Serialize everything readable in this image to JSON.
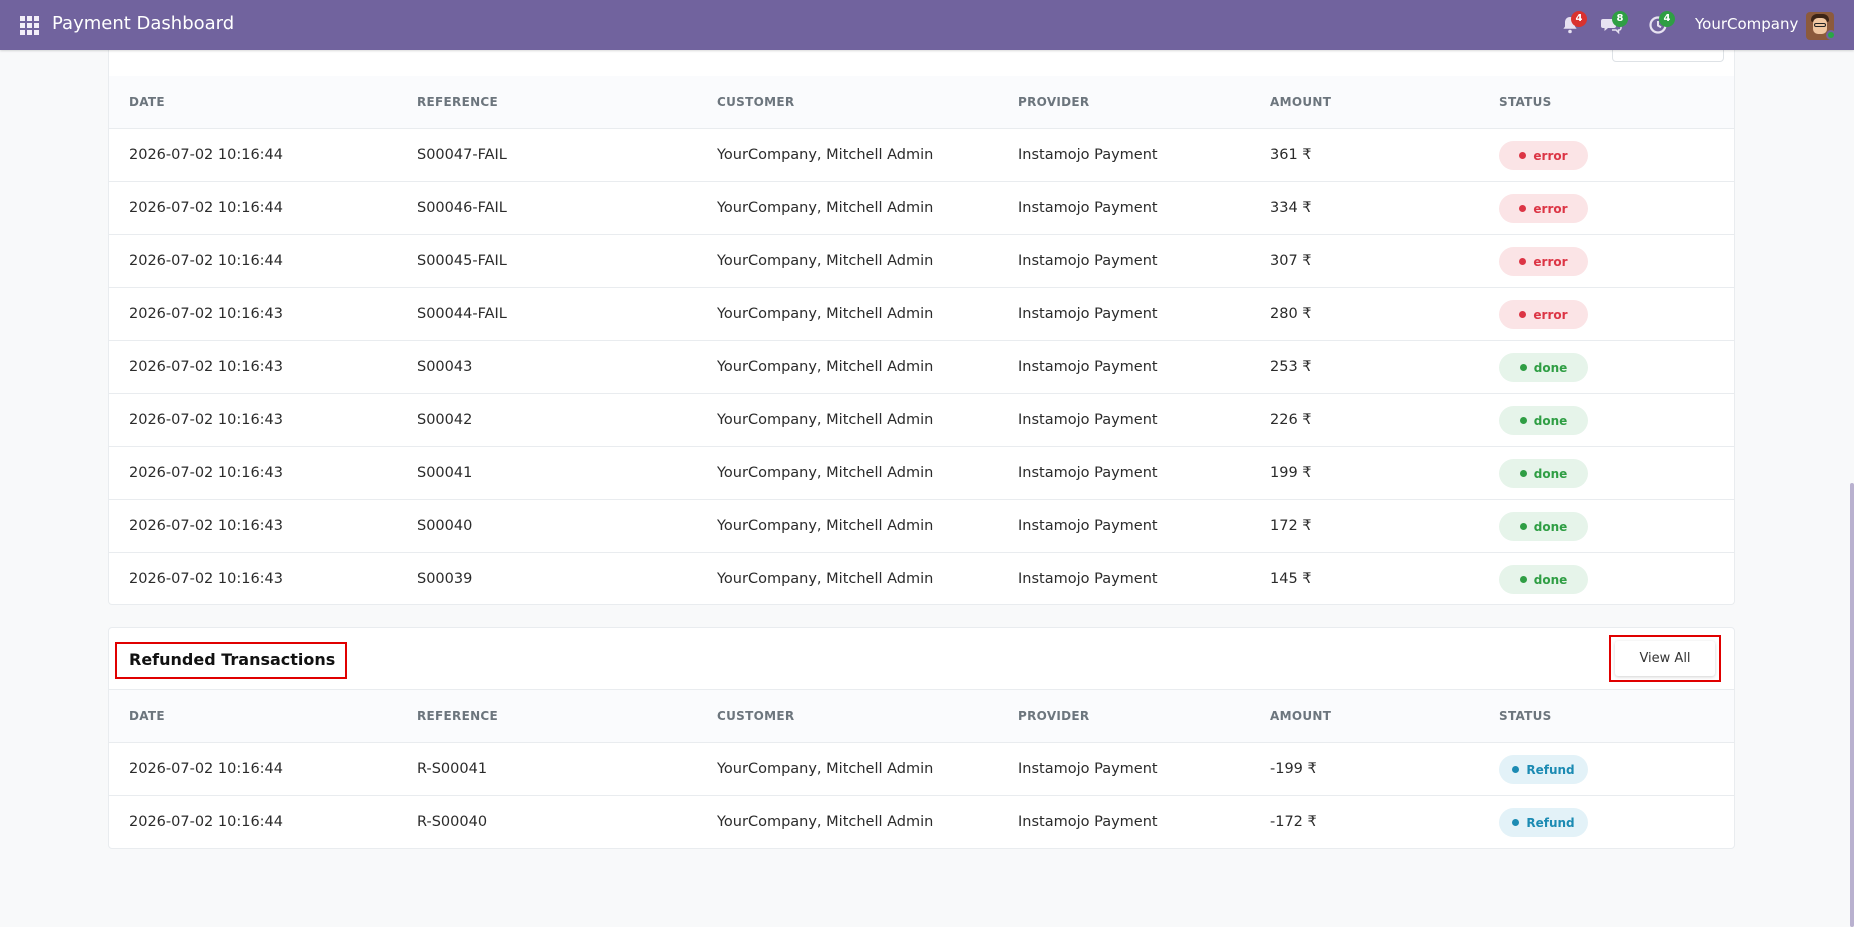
{
  "topbar": {
    "title": "Payment Dashboard",
    "company": "YourCompany",
    "notifications_count": "4",
    "messages_count": "8",
    "activities_count": "4",
    "icons": [
      "apps-grid-icon",
      "bell-icon",
      "chat-icon",
      "clock-icon",
      "avatar"
    ]
  },
  "colors": {
    "navbar": "#71639e",
    "error": "#dc3545",
    "done": "#2f9e44",
    "refund": "#1c8bb3"
  },
  "columns": [
    "DATE",
    "REFERENCE",
    "CUSTOMER",
    "PROVIDER",
    "AMOUNT",
    "STATUS"
  ],
  "transactions": {
    "rows": [
      {
        "date": "2026-07-02 10:16:44",
        "reference": "S00047-FAIL",
        "customer": "YourCompany, Mitchell Admin",
        "provider": "Instamojo Payment",
        "amount": "361 ₹",
        "status": "error"
      },
      {
        "date": "2026-07-02 10:16:44",
        "reference": "S00046-FAIL",
        "customer": "YourCompany, Mitchell Admin",
        "provider": "Instamojo Payment",
        "amount": "334 ₹",
        "status": "error"
      },
      {
        "date": "2026-07-02 10:16:44",
        "reference": "S00045-FAIL",
        "customer": "YourCompany, Mitchell Admin",
        "provider": "Instamojo Payment",
        "amount": "307 ₹",
        "status": "error"
      },
      {
        "date": "2026-07-02 10:16:43",
        "reference": "S00044-FAIL",
        "customer": "YourCompany, Mitchell Admin",
        "provider": "Instamojo Payment",
        "amount": "280 ₹",
        "status": "error"
      },
      {
        "date": "2026-07-02 10:16:43",
        "reference": "S00043",
        "customer": "YourCompany, Mitchell Admin",
        "provider": "Instamojo Payment",
        "amount": "253 ₹",
        "status": "done"
      },
      {
        "date": "2026-07-02 10:16:43",
        "reference": "S00042",
        "customer": "YourCompany, Mitchell Admin",
        "provider": "Instamojo Payment",
        "amount": "226 ₹",
        "status": "done"
      },
      {
        "date": "2026-07-02 10:16:43",
        "reference": "S00041",
        "customer": "YourCompany, Mitchell Admin",
        "provider": "Instamojo Payment",
        "amount": "199 ₹",
        "status": "done"
      },
      {
        "date": "2026-07-02 10:16:43",
        "reference": "S00040",
        "customer": "YourCompany, Mitchell Admin",
        "provider": "Instamojo Payment",
        "amount": "172 ₹",
        "status": "done"
      },
      {
        "date": "2026-07-02 10:16:43",
        "reference": "S00039",
        "customer": "YourCompany, Mitchell Admin",
        "provider": "Instamojo Payment",
        "amount": "145 ₹",
        "status": "done"
      }
    ]
  },
  "refunded": {
    "title": "Refunded Transactions",
    "view_all_label": "View All",
    "rows": [
      {
        "date": "2026-07-02 10:16:44",
        "reference": "R-S00041",
        "customer": "YourCompany, Mitchell Admin",
        "provider": "Instamojo Payment",
        "amount": "-199 ₹",
        "status": "Refund"
      },
      {
        "date": "2026-07-02 10:16:44",
        "reference": "R-S00040",
        "customer": "YourCompany, Mitchell Admin",
        "provider": "Instamojo Payment",
        "amount": "-172 ₹",
        "status": "Refund"
      }
    ]
  }
}
